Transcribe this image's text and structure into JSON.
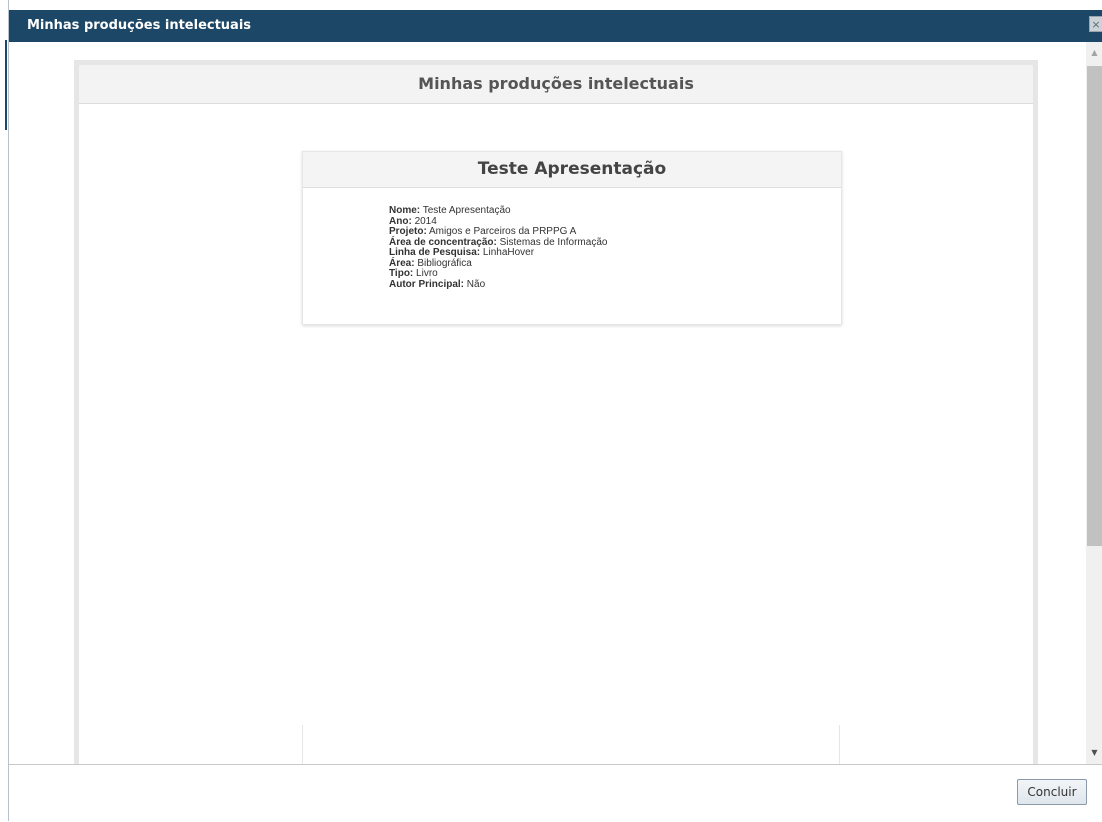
{
  "dialog": {
    "title": "Minhas produções intelectuais",
    "close_icon": "×"
  },
  "panel": {
    "title": "Minhas produções intelectuais"
  },
  "card": {
    "title": "Teste Apresentação",
    "fields": [
      {
        "label": "Nome:",
        "value": "Teste Apresentação"
      },
      {
        "label": "Ano:",
        "value": "2014"
      },
      {
        "label": "Projeto:",
        "value": "Amigos e Parceiros da PRPPG A"
      },
      {
        "label": "Área de concentração:",
        "value": "Sistemas de Informação"
      },
      {
        "label": "Linha de Pesquisa:",
        "value": "LinhaHover"
      },
      {
        "label": "Área:",
        "value": "Bibliográfica"
      },
      {
        "label": "Tipo:",
        "value": "Livro"
      },
      {
        "label": "Autor Principal:",
        "value": "Não"
      }
    ]
  },
  "footer": {
    "confirm_label": "Concluir"
  },
  "colors": {
    "titlebar": "#1c4767",
    "panel_border": "#e6e6e6"
  }
}
